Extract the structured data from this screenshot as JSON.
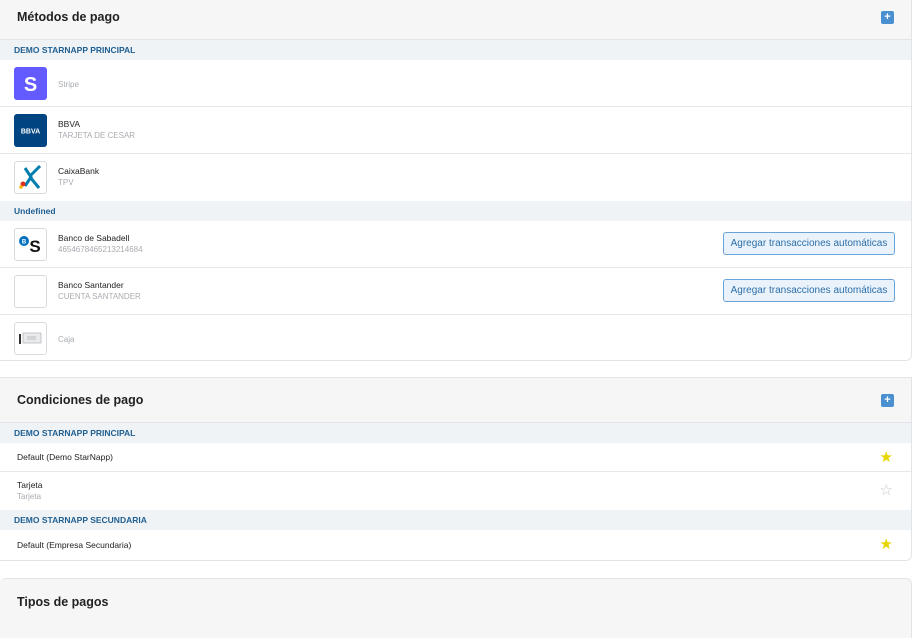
{
  "payment_methods": {
    "title": "Métodos de pago",
    "add_icon": "plus-icon",
    "groups": [
      {
        "label": "DEMO STARNAPP PRINCIPAL",
        "items": [
          {
            "name": "",
            "subtitle": "Stripe",
            "logo": "stripe-logo",
            "logo_text": "S",
            "color": "#635bff"
          },
          {
            "name": "BBVA",
            "subtitle": "TARJETA DE CESAR",
            "logo": "bbva-logo",
            "logo_text": "BBVA",
            "color": "#004481"
          },
          {
            "name": "CaixaBank",
            "subtitle": "TPV",
            "logo": "caixabank-logo",
            "color": "#007eae"
          }
        ]
      },
      {
        "label": "Undefined",
        "items": [
          {
            "name": "Banco de Sabadell",
            "subtitle": "4654678465213214684",
            "logo": "sabadell-logo",
            "logo_text": "S",
            "action": "Agregar transacciones automáticas"
          },
          {
            "name": "Banco Santander",
            "subtitle": "CUENTA SANTANDER",
            "logo": "santander-logo",
            "action": "Agregar transacciones automáticas"
          },
          {
            "name": "",
            "subtitle": "Caja",
            "logo": "cash-register-logo"
          }
        ]
      }
    ]
  },
  "payment_conditions": {
    "title": "Condiciones de pago",
    "add_icon": "plus-icon",
    "groups": [
      {
        "label": "DEMO STARNAPP PRINCIPAL",
        "items": [
          {
            "name": "Default (Demo StarNapp)",
            "subtitle": "",
            "default": true
          },
          {
            "name": "Tarjeta",
            "subtitle": "Tarjeta",
            "default": false
          }
        ]
      },
      {
        "label": "DEMO STARNAPP SECUNDARIA",
        "items": [
          {
            "name": "Default (Empresa Secundaria)",
            "subtitle": "",
            "default": true
          }
        ]
      }
    ]
  },
  "payment_types": {
    "title": "Tipos de pagos"
  },
  "colors": {
    "accent": "#4a8fcf",
    "group_label": "#1f5f91",
    "star_filled": "#e6d600",
    "star_empty": "#c5c8cc"
  }
}
